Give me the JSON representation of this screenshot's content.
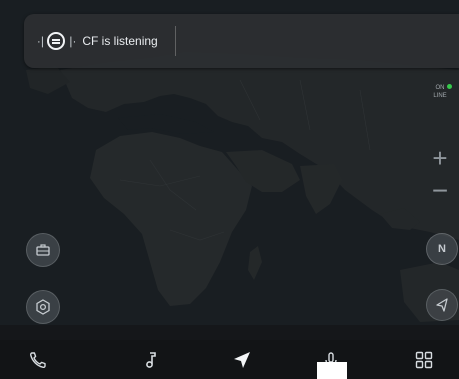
{
  "voice_assistant": {
    "status_text": "CF is listening",
    "wave_left": "·∣",
    "wave_right": "∣·",
    "icon": "assistant-icon"
  },
  "map": {
    "zoom_in_label": "+",
    "zoom_out_label": "−",
    "compass_label": "N",
    "live_badge": "ON\nLINE",
    "colors": {
      "ocean": "#1f252a",
      "land": "#2d3234",
      "accent_green": "#36c94b"
    }
  },
  "controls": {
    "left_top_icon": "briefcase-icon",
    "left_bottom_icon": "settings-icon",
    "right_bottom_icon": "recenter-arrow-icon"
  },
  "bottom_nav": {
    "items": [
      {
        "name": "phone",
        "icon": "phone-icon"
      },
      {
        "name": "music",
        "icon": "music-note-icon"
      },
      {
        "name": "navigation",
        "icon": "navigation-arrow-icon",
        "active": true
      },
      {
        "name": "voice",
        "icon": "microphone-icon"
      },
      {
        "name": "apps",
        "icon": "apps-grid-icon"
      }
    ]
  }
}
